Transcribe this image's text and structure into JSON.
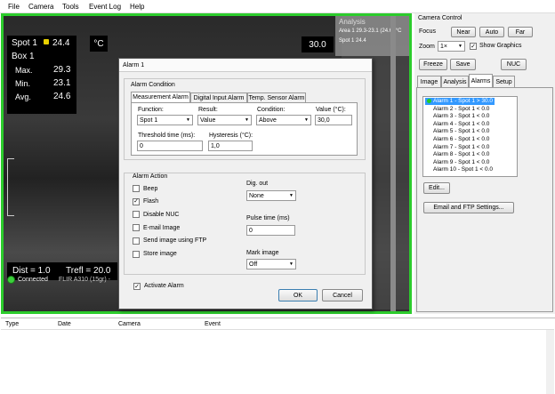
{
  "menu": [
    "File",
    "Camera",
    "Tools",
    "Event Log",
    "Help"
  ],
  "camera": {
    "spot_label": "Spot 1",
    "spot_value": "24.4",
    "unit": "°C",
    "box_label": "Box 1",
    "max_label": "Max.",
    "max_value": "29.3",
    "min_label": "Min.",
    "min_value": "23.1",
    "avg_label": "Avg.",
    "avg_value": "24.6",
    "scale_top": "30.0",
    "dist": "Dist = 1.0",
    "trefl": "Trefl = 20.0",
    "status": "Connected",
    "camera_name": "FLIR A310 (15gr) -",
    "analysis_title": "Analysis",
    "analysis_area": "Area 1 29.3-23.1 (24.6) °C",
    "analysis_spot": "Spot 1 24.4"
  },
  "control": {
    "title": "Camera Control",
    "focus_label": "Focus",
    "near": "Near",
    "auto": "Auto",
    "far": "Far",
    "zoom_label": "Zoom",
    "zoom_value": "1×",
    "show_graphics": "Show Graphics",
    "freeze": "Freeze",
    "save": "Save",
    "nuc": "NUC",
    "tabs": [
      "Image",
      "Analysis",
      "Alarms",
      "Setup"
    ],
    "alarms": [
      "Alarm 1 - Spot 1  > 30.0",
      "Alarm 2 - Spot 1  < 0.0",
      "Alarm 3 - Spot 1  < 0.0",
      "Alarm 4 - Spot 1  < 0.0",
      "Alarm 5 - Spot 1  < 0.0",
      "Alarm 6 - Spot 1  < 0.0",
      "Alarm 7 - Spot 1  < 0.0",
      "Alarm 8 - Spot 1  < 0.0",
      "Alarm 9 - Spot 1  < 0.0",
      "Alarm 10 - Spot 1  < 0.0"
    ],
    "edit": "Edit...",
    "email_ftp": "Email and FTP Settings..."
  },
  "eventlog": {
    "columns": [
      "Type",
      "Date",
      "Camera",
      "Event"
    ]
  },
  "dialog": {
    "title": "Alarm 1",
    "condition_group": "Alarm Condition",
    "tabs": [
      "Measurement Alarm",
      "Digital Input Alarm",
      "Temp. Sensor Alarm"
    ],
    "function_label": "Function:",
    "function_value": "Spot 1",
    "result_label": "Result:",
    "result_value": "Value",
    "condition_label": "Condition:",
    "condition_value": "Above",
    "value_label": "Value (°C):",
    "value_value": "30,0",
    "threshold_label": "Threshold time (ms):",
    "threshold_value": "0",
    "hysteresis_label": "Hysteresis (°C):",
    "hysteresis_value": "1,0",
    "action_group": "Alarm Action",
    "actions": [
      {
        "label": "Beep",
        "checked": ""
      },
      {
        "label": "Flash",
        "checked": "✓"
      },
      {
        "label": "Disable NUC",
        "checked": ""
      },
      {
        "label": "E-mail Image",
        "checked": ""
      },
      {
        "label": "Send image using FTP",
        "checked": ""
      },
      {
        "label": "Store image",
        "checked": ""
      }
    ],
    "dig_out_label": "Dig. out",
    "dig_out_value": "None",
    "pulse_label": "Pulse time (ms)",
    "pulse_value": "0",
    "mark_label": "Mark image",
    "mark_value": "Off",
    "activate_label": "Activate Alarm",
    "activate_checked": "✓",
    "ok": "OK",
    "cancel": "Cancel"
  }
}
